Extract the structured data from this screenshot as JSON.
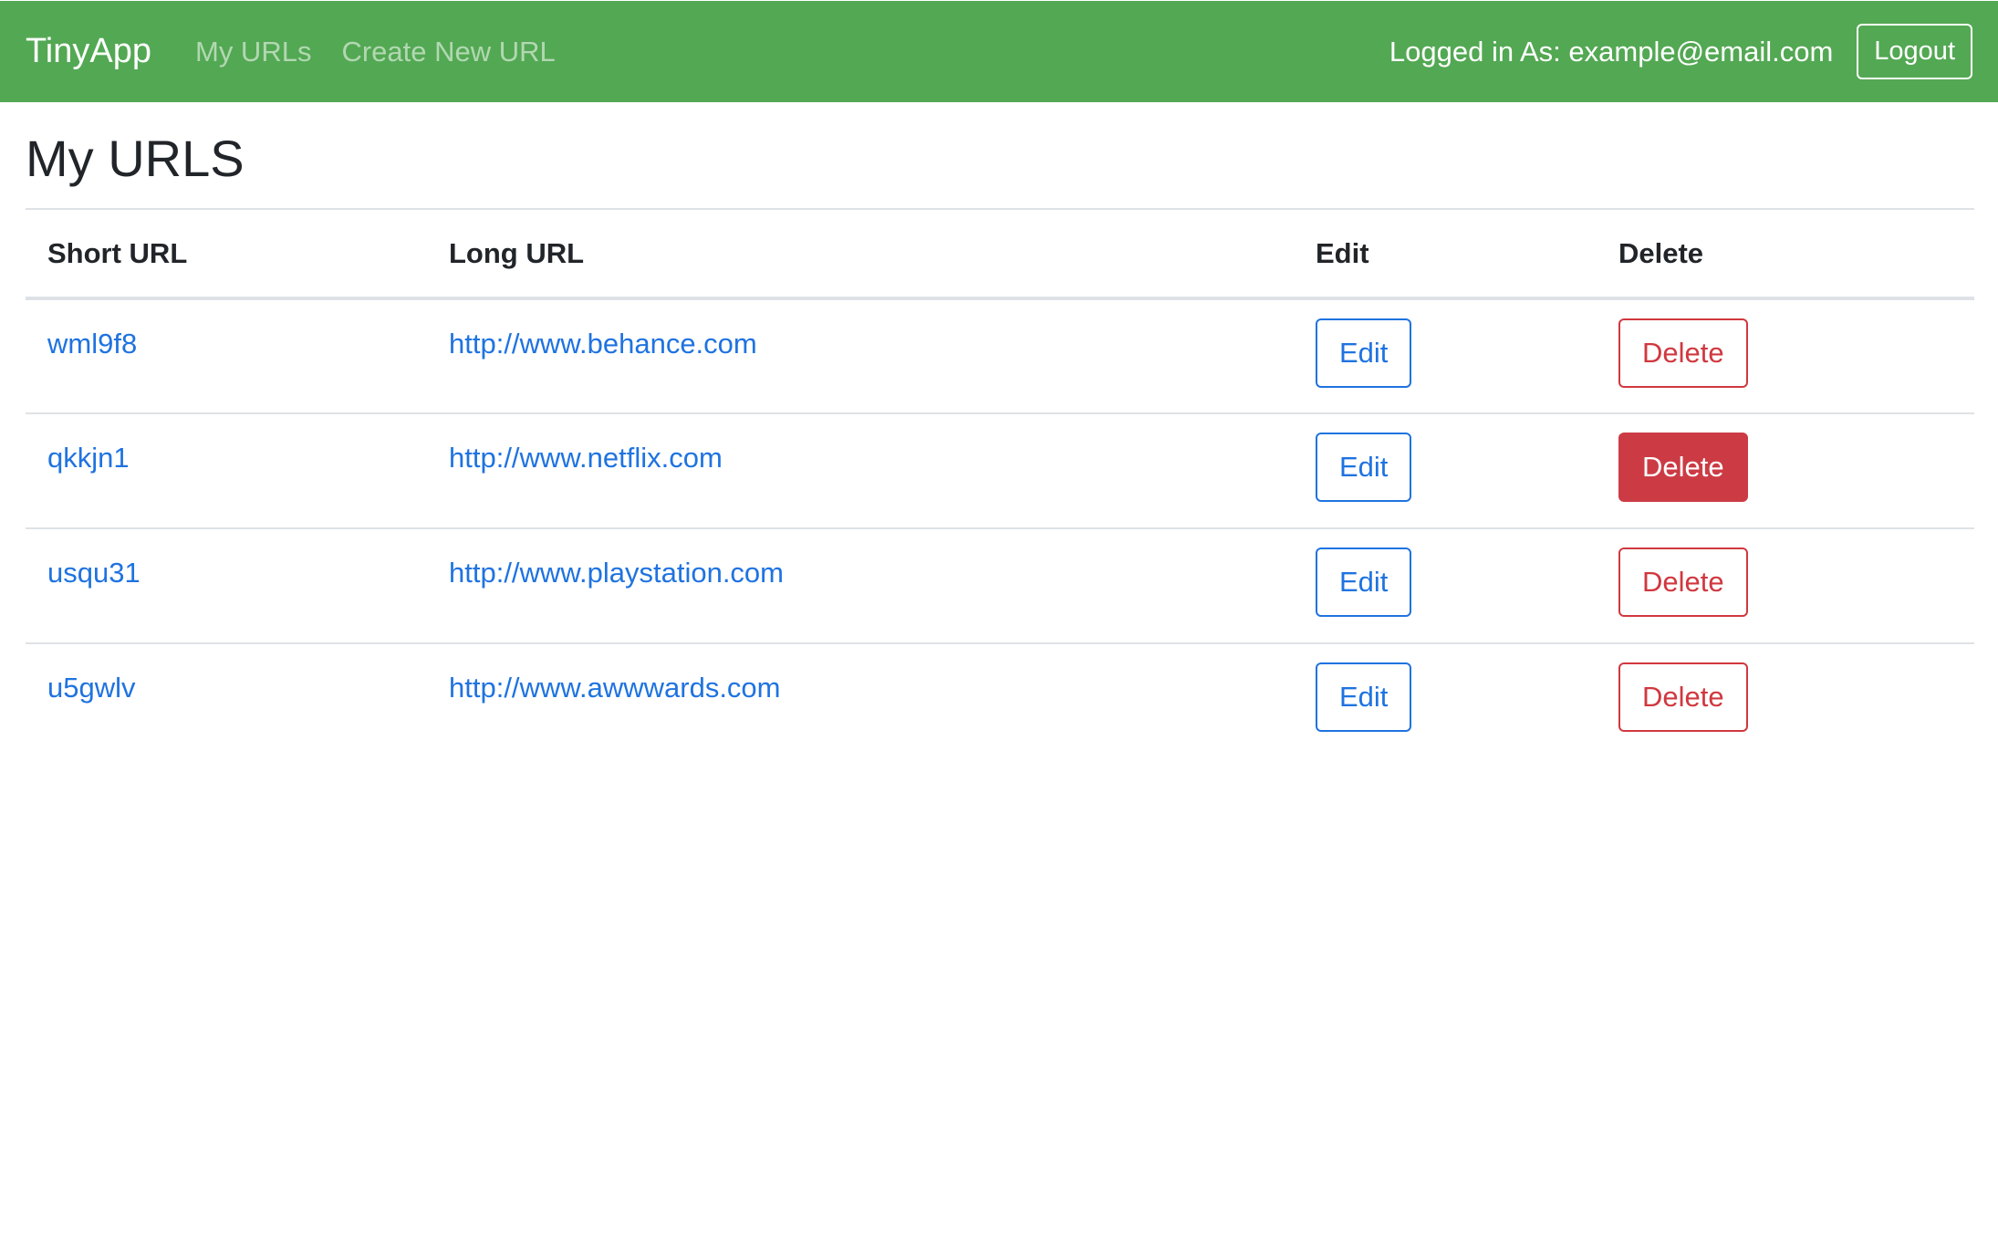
{
  "navbar": {
    "brand": "TinyApp",
    "links": [
      "My URLs",
      "Create New URL"
    ],
    "logged_in_text": "Logged in As: example@email.com",
    "logout_label": "Logout",
    "background_color": "#53a853"
  },
  "main": {
    "title": "My URLS",
    "table": {
      "headers": [
        "Short URL",
        "Long URL",
        "Edit",
        "Delete"
      ],
      "rows": [
        {
          "short": "wml9f8",
          "long": "http://www.behance.com",
          "edit": "Edit",
          "delete": "Delete",
          "delete_hover": false
        },
        {
          "short": "qkkjn1",
          "long": "http://www.netflix.com",
          "edit": "Edit",
          "delete": "Delete",
          "delete_hover": true
        },
        {
          "short": "usqu31",
          "long": "http://www.playstation.com",
          "edit": "Edit",
          "delete": "Delete",
          "delete_hover": false
        },
        {
          "short": "u5gwlv",
          "long": "http://www.awwwards.com",
          "edit": "Edit",
          "delete": "Delete",
          "delete_hover": false
        }
      ]
    }
  },
  "colors": {
    "link": "#1f73e0",
    "danger": "#cc3b44"
  }
}
